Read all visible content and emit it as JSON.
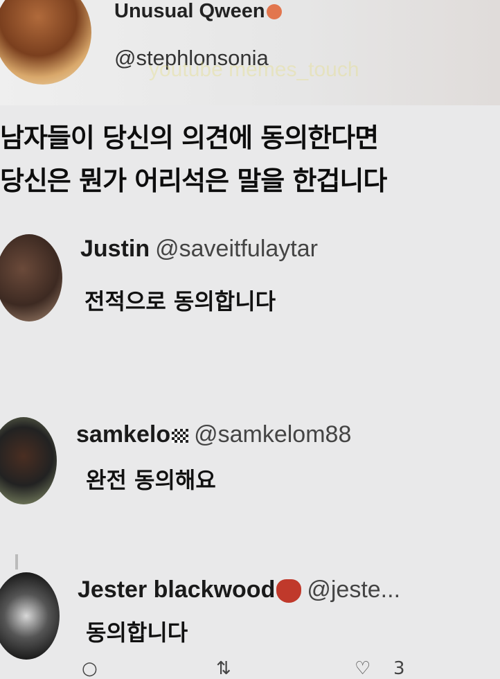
{
  "post": {
    "author_name": "Unusual Qween",
    "author_handle": "@stephlonsonia",
    "watermark": "youtube memes_touch",
    "text_line1": "남자들이 당신의 의견에 동의한다면",
    "text_line2": "당신은 뭔가 어리석은 말을 한겁니다"
  },
  "replies": [
    {
      "name": "Justin",
      "handle": "@saveitfulaytar",
      "text": "전적으로 동의합니다"
    },
    {
      "name": "samkelo",
      "handle": "@samkelom88",
      "text": "완전 동의해요"
    },
    {
      "name": "Jester blackwood",
      "handle": "@jeste...",
      "text": "동의합니다"
    }
  ],
  "actions": {
    "reply_icon": "comment-icon",
    "retweet_icon": "retweet-icon",
    "like_icon": "heart-icon",
    "like_count": "3"
  },
  "colors": {
    "background": "#e9e9ea",
    "text": "#111111"
  }
}
